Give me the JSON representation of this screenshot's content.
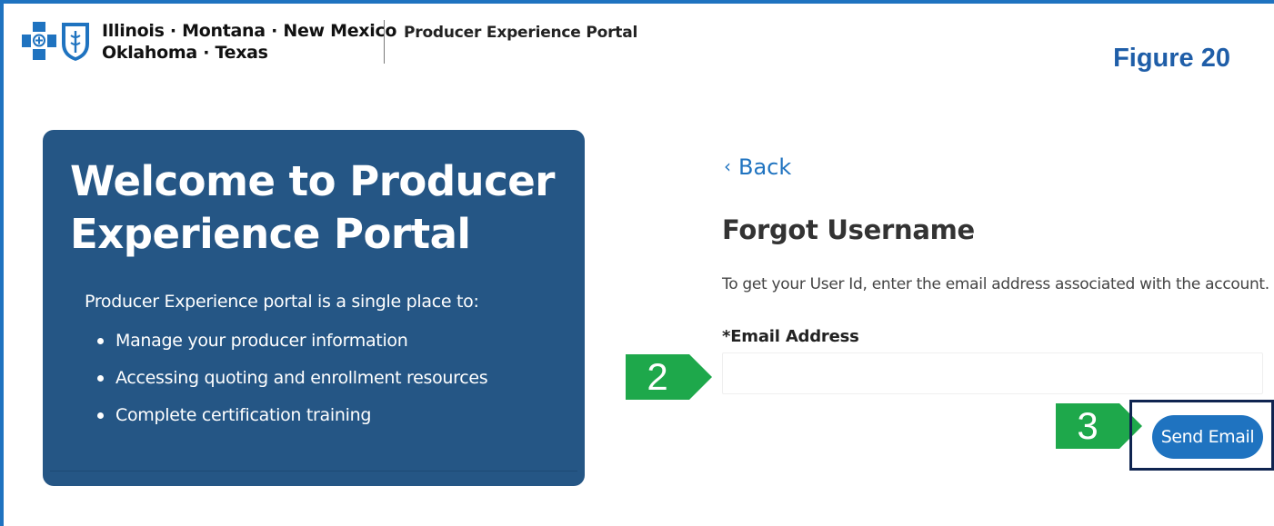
{
  "header": {
    "brand_line1": "Illinois · Montana · New Mexico",
    "brand_line2": "Oklahoma · Texas",
    "portal_name": "Producer Experience Portal",
    "figure_label": "Figure 20"
  },
  "welcome": {
    "title": "Welcome to Producer Experience Portal",
    "intro": "Producer Experience portal is a single place to:",
    "bullets": [
      "Manage your producer information",
      "Accessing quoting and enrollment resources",
      "Complete certification training"
    ]
  },
  "form": {
    "back_label": "Back",
    "title": "Forgot Username",
    "description": "To get your User Id, enter the email address associated with the account.",
    "email_label": "*Email Address",
    "email_value": "",
    "send_label": "Send Email"
  },
  "callouts": {
    "step2": "2",
    "step3": "3"
  },
  "icons": {
    "cross_logo": "blue-cross-icon",
    "shield_logo": "blue-shield-icon",
    "back": "chevron-left-icon"
  },
  "colors": {
    "brand_blue": "#1f73c0",
    "card_blue": "#255685",
    "callout_green": "#1ea84b",
    "highlight_navy": "#0f2450",
    "figure_label": "#1f5ea8"
  }
}
